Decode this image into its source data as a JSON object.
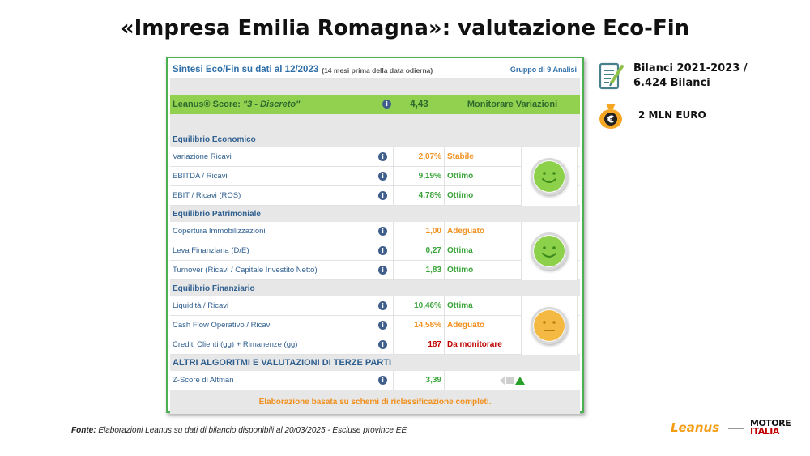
{
  "slide": {
    "title": "«Impresa Emilia Romagna»: valutazione Eco-Fin"
  },
  "panel": {
    "header_title": "Sintesi Eco/Fin su dati al 12/2023",
    "header_sub": "(14 mesi prima della data odierna)",
    "header_group": "Gruppo di 9 Analisi",
    "score_label_prefix": "Leanus® Score: ",
    "score_label_value": "\"3 - Discreto\"",
    "score_value": "4,43",
    "score_action": "Monitorare Variazioni",
    "info_glyph": "i",
    "sections": [
      {
        "title": "Equilibrio Economico",
        "smiley": "green",
        "rows": [
          {
            "name": "Variazione Ricavi",
            "value": "2,07%",
            "label": "Stabile",
            "color": "#f0901e"
          },
          {
            "name": "EBITDA / Ricavi",
            "value": "9,19%",
            "label": "Ottimo",
            "color": "#3aa43a"
          },
          {
            "name": "EBIT / Ricavi (ROS)",
            "value": "4,78%",
            "label": "Ottimo",
            "color": "#3aa43a"
          }
        ]
      },
      {
        "title": "Equilibrio Patrimoniale",
        "smiley": "green",
        "rows": [
          {
            "name": "Copertura Immobilizzazioni",
            "value": "1,00",
            "label": "Adeguato",
            "color": "#f0901e"
          },
          {
            "name": "Leva Finanziaria (D/E)",
            "value": "0,27",
            "label": "Ottima",
            "color": "#3aa43a"
          },
          {
            "name": "Turnover (Ricavi / Capitale Investito Netto)",
            "value": "1,83",
            "label": "Ottimo",
            "color": "#3aa43a"
          }
        ]
      },
      {
        "title": "Equilibrio Finanziario",
        "smiley": "orange",
        "rows": [
          {
            "name": "Liquidità / Ricavi",
            "value": "10,46%",
            "label": "Ottima",
            "color": "#3aa43a"
          },
          {
            "name": "Cash Flow Operativo / Ricavi",
            "value": "14,58%",
            "label": "Adeguato",
            "color": "#f0901e"
          },
          {
            "name": "Crediti Clienti (gg) + Rimanenze (gg)",
            "value": "187",
            "label": "Da monitorare",
            "color": "#c00000"
          }
        ]
      }
    ],
    "third_party_title": "ALTRI ALGORITMI E VALUTAZIONI DI TERZE PARTI",
    "altman": {
      "name": "Z-Score di Altman",
      "value": "3,39",
      "trend": "up",
      "color": "#3aa43a"
    },
    "footer": "Elaborazione basata su schemi di riclassificazione completi."
  },
  "side": {
    "doc_line1": "Bilanci 2021-2023 /",
    "doc_line2": "6.424 Bilanci",
    "doc_icon": "document-pen-icon",
    "money_icon": "euro-bag-icon",
    "money_label": "2 MLN EURO"
  },
  "source": {
    "prefix": "Fonte:",
    "text": " Elaborazioni Leanus su dati di bilancio disponibili al 20/03/2025 - Escluse province EE"
  },
  "logos": {
    "leanus": "Leanus",
    "motore_line1": "MOTORE",
    "motore_line2": "ITALIA"
  },
  "colors": {
    "accent_green": "#92d050",
    "panel_border": "#4caf50",
    "title_blue": "#2f6fa8",
    "warn_orange": "#f0901e",
    "ok_green": "#3aa43a",
    "alert_red": "#c00000"
  }
}
